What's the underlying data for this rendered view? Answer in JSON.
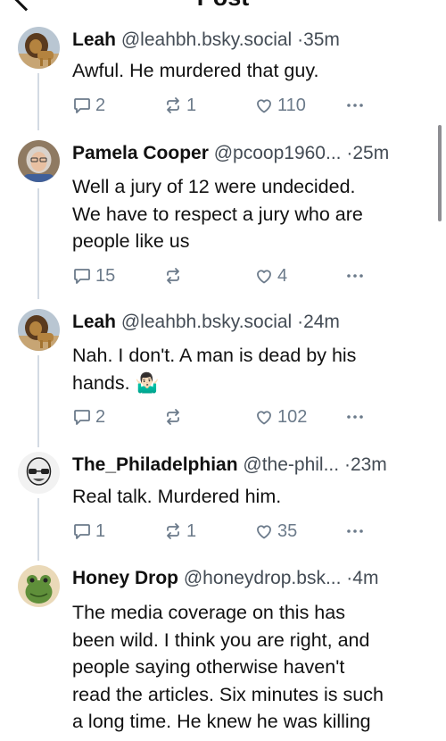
{
  "header": {
    "title": "Post"
  },
  "posts": [
    {
      "name": "Leah",
      "handle": "@leahbh.bsky.social",
      "separator": "·",
      "time": "35m",
      "avatar": "lion-avatar",
      "lines": [
        "Awful. He murdered that guy."
      ],
      "replies": "2",
      "reposts": "1",
      "likes": "110"
    },
    {
      "name": "Pamela Cooper",
      "handle": "@pcoop1960...",
      "separator": "·",
      "time": "25m",
      "avatar": "woman-glasses-avatar",
      "lines": [
        "Well a jury of 12 were undecided.",
        "We have to respect a jury who are",
        "people like us"
      ],
      "replies": "15",
      "reposts": "",
      "likes": "4"
    },
    {
      "name": "Leah",
      "handle": "@leahbh.bsky.social",
      "separator": "·",
      "time": "24m",
      "avatar": "lion-avatar",
      "lines": [
        "Nah. I don't. A man is dead by his",
        "hands. 🤷🏻‍♂️"
      ],
      "replies": "2",
      "reposts": "",
      "likes": "102"
    },
    {
      "name": "The_Philadelphian",
      "handle": "@the-phil...",
      "separator": "·",
      "time": "23m",
      "avatar": "bald-man-glasses-avatar",
      "lines": [
        "Real talk. Murdered him."
      ],
      "replies": "1",
      "reposts": "1",
      "likes": "35"
    },
    {
      "name": "Honey Drop",
      "handle": "@honeydrop.bsk...",
      "separator": "·",
      "time": "4m",
      "avatar": "frog-avatar",
      "lines": [
        "The media coverage on this has",
        "been wild. I think you are right, and",
        "people saying otherwise haven't",
        "read the articles. Six minutes is such",
        "a long time. He knew he was killing"
      ]
    }
  ],
  "colors": {
    "thread_line": "#d3dae3",
    "action_gray": "#6b7a8a",
    "meta_gray": "#444c55"
  }
}
